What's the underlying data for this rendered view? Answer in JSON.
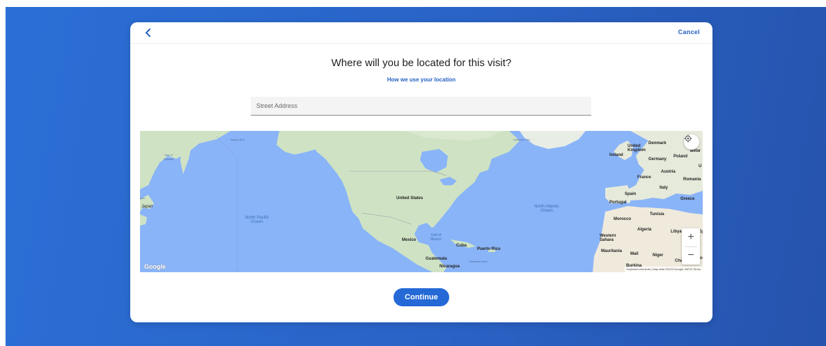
{
  "modal": {
    "cancel_label": "Cancel",
    "title": "Where will you be located for this visit?",
    "help_link": "How we use your location"
  },
  "address": {
    "placeholder": "Street Address",
    "value": ""
  },
  "map": {
    "labels": {
      "bering_sea": "Bering Sea",
      "sea_of_okhotsk": "Sea of Okhotsk",
      "labrador_sea": "Labrador Sea",
      "japan": "Japan",
      "pan": "pan",
      "north_pacific": "North Pacific Ocean",
      "north_atlantic": "North Atlantic Ocean",
      "united_states": "United States",
      "mexico": "Mexico",
      "gulf_of_mexico": "Gulf of Mexico",
      "cuba": "Cuba",
      "puerto_rico": "Puerto Rico",
      "guatemala": "Guatemala",
      "caribbean_sea": "Caribbean Sea",
      "nicaragua": "Nicaragua",
      "united_kingdom": "United Kingdom",
      "ireland": "Ireland",
      "denmark": "Denmark",
      "germany": "Germany",
      "poland": "Poland",
      "belarus": "Belar",
      "ukraine": "U",
      "france": "France",
      "austria": "Austria",
      "romania": "Romania",
      "italy": "Italy",
      "spain": "Spain",
      "portugal": "Portugal",
      "greece": "Greece",
      "tunisia": "Tunisia",
      "morocco": "Morocco",
      "algeria": "Algeria",
      "libya": "Libya",
      "egypt": "Eg",
      "western_sahara": "Western Sahara",
      "mauritania": "Mauritania",
      "mali": "Mali",
      "niger": "Niger",
      "chad": "Chad",
      "sudan": "Su",
      "burkina": "Burkina"
    },
    "logo": "Google",
    "attribution": {
      "shortcuts": "Keyboard shortcuts",
      "map_data": "Map data ©2023 Google, INEGI",
      "terms": "Terms"
    },
    "zoom_in_label": "+",
    "zoom_out_label": "−"
  },
  "continue_label": "Continue",
  "icons": {
    "back": "chevron-left-icon",
    "locate": "my-location-icon"
  },
  "colors": {
    "backdrop": "#2a63c6",
    "accent": "#2469d6",
    "link": "#2461c4",
    "water": "#8ab4f8",
    "land": "#cfe3c4"
  }
}
